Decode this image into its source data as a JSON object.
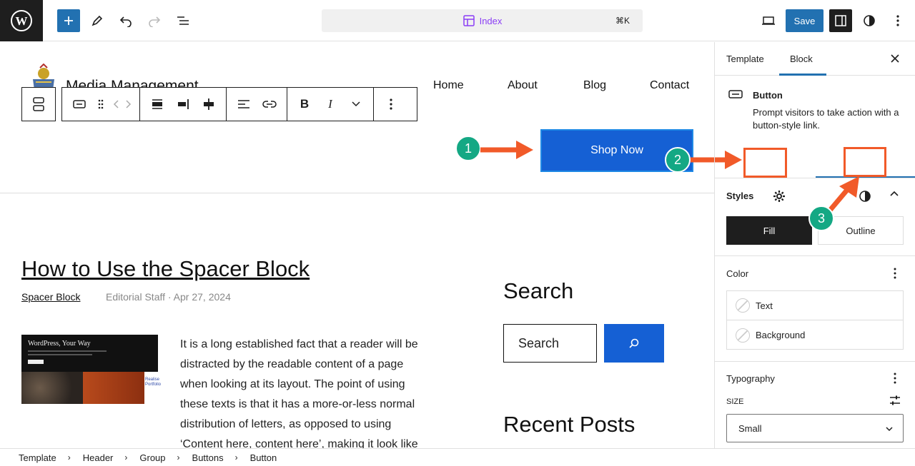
{
  "editor": {
    "document_title": "Index",
    "shortcut": "⌘K",
    "save_label": "Save"
  },
  "site": {
    "title": "Media Management",
    "nav": [
      "Home",
      "About",
      "Blog",
      "Contact"
    ],
    "cta": "Shop Now"
  },
  "post": {
    "title": "How to Use the Spacer Block",
    "category": "Spacer Block",
    "meta": "Editorial Staff · Apr 27, 2024",
    "thumbnail_heading": "WordPress, Your Way",
    "thumbnail_side_text": "Realise Portfolio",
    "excerpt_lines": [
      "It is a long established fact that a reader will be",
      "distracted by the readable content of a page",
      "when looking at its layout. The point of using",
      "these texts is that it has a more-or-less normal",
      "distribution of letters, as opposed to using",
      "‘Content here, content here’, making it look like"
    ]
  },
  "sidebar_widgets": {
    "search_heading": "Search",
    "search_placeholder": "Search",
    "recent_heading": "Recent Posts"
  },
  "inspector": {
    "tabs": [
      "Template",
      "Block"
    ],
    "active_tab": "Block",
    "block_name": "Button",
    "block_description": "Prompt visitors to take action with a button-style link.",
    "styles": {
      "title": "Styles",
      "options": [
        "Fill",
        "Outline"
      ],
      "selected": "Fill"
    },
    "color": {
      "title": "Color",
      "items": [
        "Text",
        "Background"
      ]
    },
    "typography": {
      "title": "Typography",
      "size_label": "SIZE",
      "size_value": "Small"
    }
  },
  "breadcrumbs": [
    "Template",
    "Header",
    "Group",
    "Buttons",
    "Button"
  ],
  "annotations": [
    "1",
    "2",
    "3"
  ],
  "colors": {
    "accent": "#2271b1",
    "button": "#1560d4",
    "annotation": "#f15a29",
    "badge": "#14a884"
  }
}
